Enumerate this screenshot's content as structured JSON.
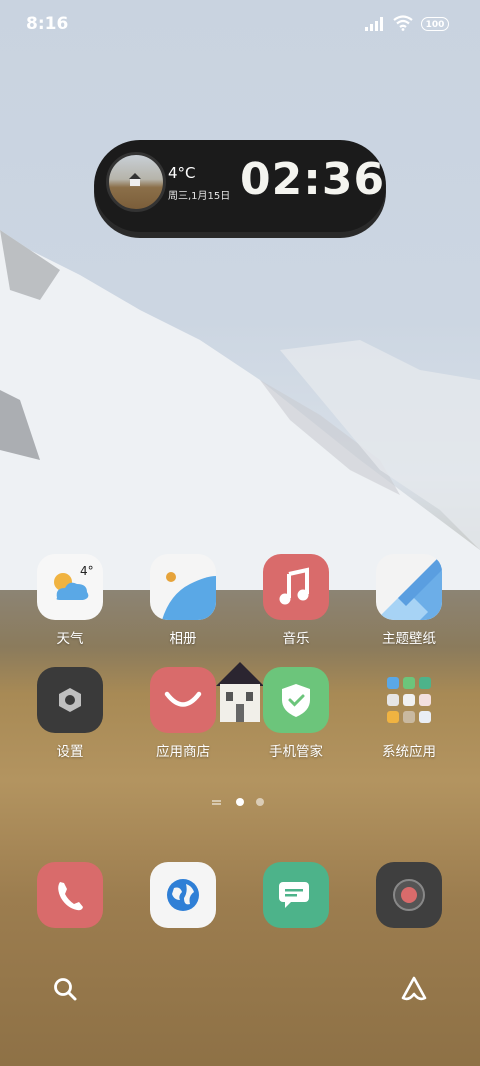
{
  "status_bar": {
    "time": "8:16",
    "battery": "100"
  },
  "widget": {
    "temperature": "4°C",
    "date": "周三,1月15日",
    "clock": "02:36"
  },
  "apps_row1": [
    {
      "label": "天气",
      "icon": "weather-icon",
      "badge": "4°"
    },
    {
      "label": "相册",
      "icon": "gallery-icon"
    },
    {
      "label": "音乐",
      "icon": "music-icon"
    },
    {
      "label": "主题壁纸",
      "icon": "themes-icon"
    }
  ],
  "apps_row2": [
    {
      "label": "设置",
      "icon": "settings-icon"
    },
    {
      "label": "应用商店",
      "icon": "app-store-icon"
    },
    {
      "label": "手机管家",
      "icon": "security-icon"
    },
    {
      "label": "系统应用",
      "icon": "folder-icon"
    }
  ],
  "dock": [
    {
      "icon": "phone-icon"
    },
    {
      "icon": "browser-icon"
    },
    {
      "icon": "messages-icon"
    },
    {
      "icon": "camera-icon"
    }
  ],
  "colors": {
    "music": "#d96b6b",
    "app_store": "#d96b6b",
    "security": "#6cc57b",
    "phone": "#d96b6b",
    "messages": "#4db38a",
    "settings": "#3a3a3a",
    "camera": "#3f3f3f"
  }
}
